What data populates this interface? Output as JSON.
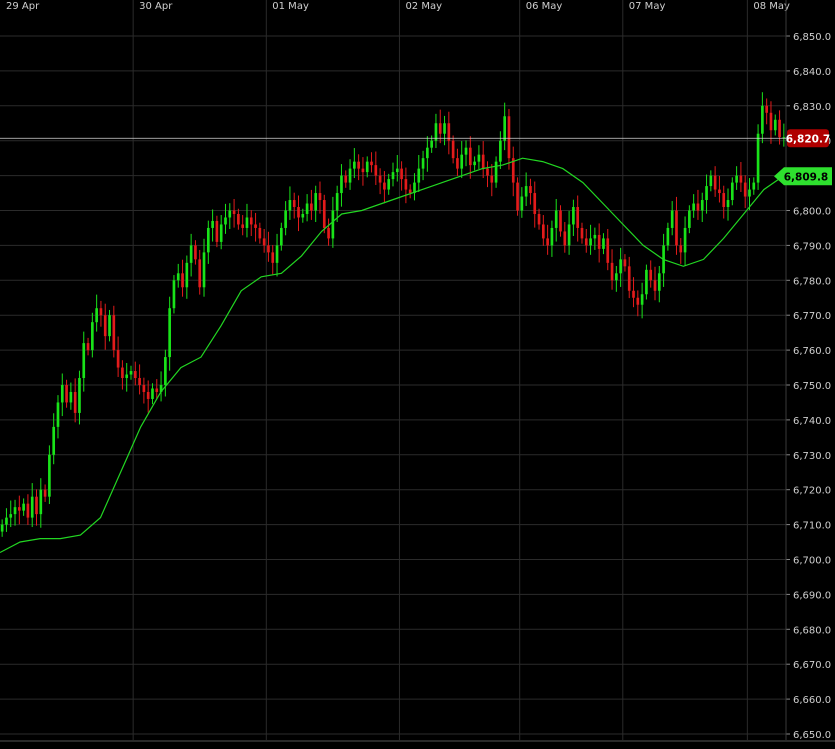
{
  "chart_data": {
    "type": "candlestick",
    "title": "",
    "xlabel": "",
    "ylabel": "",
    "ylim": [
      6650,
      6855
    ],
    "y_ticks": [
      6850,
      6840,
      6830,
      6820,
      6810,
      6800,
      6790,
      6780,
      6770,
      6760,
      6750,
      6740,
      6730,
      6720,
      6710,
      6700,
      6690,
      6680,
      6670,
      6660,
      6650
    ],
    "y_tick_labels": [
      "6,850.0",
      "6,840.0",
      "6,830.0",
      "6,820.0",
      "6,810.0",
      "6,800.0",
      "6,790.0",
      "6,780.0",
      "6,770.0",
      "6,760.0",
      "6,750.0",
      "6,740.0",
      "6,730.0",
      "6,720.0",
      "6,710.0",
      "6,700.0",
      "6,690.0",
      "6,680.0",
      "6,670.0",
      "6,660.0",
      "6,650.0"
    ],
    "date_labels": [
      "29 Apr",
      "30 Apr",
      "01 May",
      "02 May",
      "06 May",
      "07 May",
      "08 May"
    ],
    "date_boundaries": [
      0,
      31,
      62,
      93,
      121,
      145,
      174
    ],
    "grid": true,
    "legend": "none",
    "colors": {
      "background": "#000000",
      "grid": "#2b2b2b",
      "up": "#19e319",
      "down": "#e31b1b",
      "ma": "#22d622",
      "axis_text": "#cfcfcf",
      "last_price_bg": "#b00000",
      "ma_price_bg": "#2ee02e"
    },
    "last_price": 6820.7,
    "last_price_label": "6,820.7",
    "ma_last": 6809.8,
    "ma_last_label": "6,809.8",
    "close_series": [
      6710,
      6712,
      6713,
      6715,
      6714,
      6716,
      6712,
      6718,
      6713,
      6720,
      6718,
      6730,
      6738,
      6745,
      6750,
      6745,
      6748,
      6742,
      6752,
      6762,
      6760,
      6768,
      6772,
      6770,
      6764,
      6770,
      6760,
      6755,
      6752,
      6753,
      6754,
      6752,
      6750,
      6748,
      6746,
      6749,
      6748,
      6750,
      6758,
      6772,
      6780,
      6782,
      6778,
      6785,
      6790,
      6786,
      6778,
      6788,
      6795,
      6797,
      6791,
      6796,
      6798,
      6800,
      6799,
      6796,
      6795,
      6798,
      6796,
      6795,
      6792,
      6790,
      6788,
      6785,
      6790,
      6795,
      6800,
      6803,
      6801,
      6798,
      6799,
      6802,
      6800,
      6805,
      6803,
      6795,
      6792,
      6800,
      6805,
      6810,
      6808,
      6812,
      6814,
      6812,
      6811,
      6814,
      6813,
      6810,
      6808,
      6806,
      6809,
      6811,
      6812,
      6809,
      6806,
      6805,
      6808,
      6812,
      6815,
      6818,
      6820,
      6825,
      6822,
      6825,
      6820,
      6815,
      6812,
      6816,
      6818,
      6813,
      6814,
      6816,
      6812,
      6810,
      6808,
      6814,
      6820,
      6827,
      6815,
      6808,
      6800,
      6804,
      6807,
      6805,
      6799,
      6796,
      6792,
      6790,
      6795,
      6800,
      6794,
      6790,
      6796,
      6801,
      6795,
      6792,
      6790,
      6792,
      6793,
      6789,
      6792,
      6785,
      6780,
      6782,
      6786,
      6784,
      6777,
      6775,
      6773,
      6776,
      6783,
      6780,
      6777,
      6782,
      6790,
      6795,
      6800,
      6790,
      6788,
      6795,
      6800,
      6802,
      6800,
      6803,
      6807,
      6810,
      6806,
      6805,
      6801,
      6803,
      6808,
      6810,
      6808,
      6804,
      6806,
      6808,
      6822,
      6830,
      6828,
      6823,
      6826,
      6821,
      6821
    ],
    "ma_series": [
      6702,
      6705,
      6706,
      6706,
      6707,
      6712,
      6725,
      6738,
      6748,
      6755,
      6758,
      6767,
      6777,
      6781,
      6782,
      6787,
      6794,
      6799,
      6800,
      6802,
      6804,
      6806,
      6808,
      6810,
      6812,
      6813,
      6815,
      6814,
      6812,
      6808,
      6802,
      6796,
      6790,
      6786,
      6784,
      6786,
      6792,
      6799,
      6806,
      6810
    ]
  }
}
